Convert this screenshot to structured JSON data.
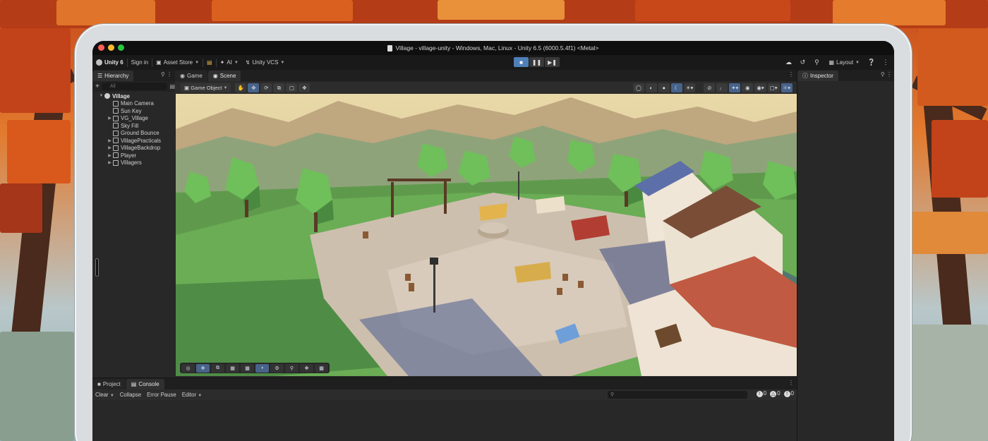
{
  "window": {
    "title": "Village - village-unity - Windows, Mac, Linux - Unity 6.5 (6000.5.4f1) <Metal>"
  },
  "toolbar": {
    "unity_label": "Unity 6",
    "sign_in": "Sign in",
    "asset_store": "Asset Store",
    "ai": "AI",
    "vcs": "Unity VCS",
    "layout": "Layout",
    "play_icons": [
      "play-icon",
      "pause-icon",
      "step-icon"
    ]
  },
  "hierarchy": {
    "tab_label": "Hierarchy",
    "search_placeholder": "All",
    "root": "Village",
    "items": [
      {
        "label": "Main Camera",
        "expandable": false
      },
      {
        "label": "Sun Key",
        "expandable": false
      },
      {
        "label": "VG_Village",
        "expandable": true
      },
      {
        "label": "Sky Fill",
        "expandable": false
      },
      {
        "label": "Ground Bounce",
        "expandable": false
      },
      {
        "label": "VillagePracticals",
        "expandable": true
      },
      {
        "label": "VillageBackdrop",
        "expandable": true
      },
      {
        "label": "Player",
        "expandable": true
      },
      {
        "label": "Villagers",
        "expandable": true
      }
    ]
  },
  "scene": {
    "tabs": [
      {
        "label": "Game",
        "active": false
      },
      {
        "label": "Scene",
        "active": true
      }
    ],
    "game_object_dropdown": "Game Object"
  },
  "inspector": {
    "tab_label": "Inspector"
  },
  "console": {
    "tabs": [
      {
        "label": "Project",
        "active": false
      },
      {
        "label": "Console",
        "active": true
      }
    ],
    "clear": "Clear",
    "collapse": "Collapse",
    "error_pause": "Error Pause",
    "editor": "Editor",
    "info_count": "0",
    "warning_count": "0",
    "error_count": "0"
  },
  "colors": {
    "accent": "#4f7fb8",
    "panel": "#282828",
    "toolbar": "#191919"
  }
}
